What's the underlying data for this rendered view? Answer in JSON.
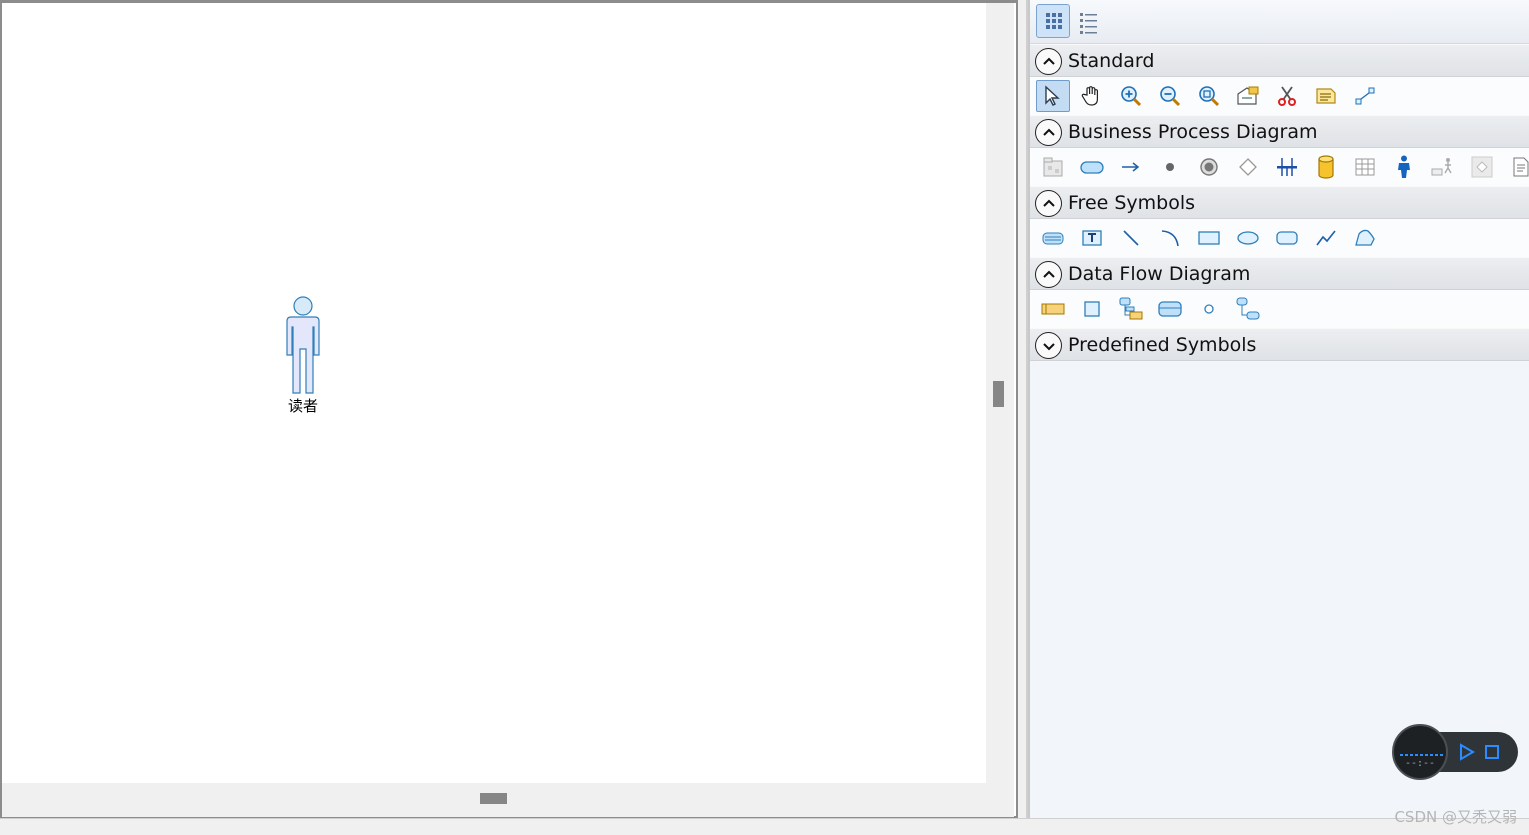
{
  "canvas": {
    "actor": {
      "label": "读者",
      "icon": "actor-icon"
    }
  },
  "toolbox": {
    "modes": [
      {
        "name": "grid-view-icon",
        "active": true
      },
      {
        "name": "list-view-icon",
        "active": false
      }
    ],
    "groups": [
      {
        "title": "Standard",
        "expanded": true,
        "tools": [
          "pointer-icon",
          "hand-icon",
          "zoom-in-icon",
          "zoom-out-icon",
          "zoom-fit-icon",
          "properties-icon",
          "cut-icon",
          "note-icon",
          "link-icon"
        ]
      },
      {
        "title": "Business Process Diagram",
        "expanded": true,
        "tools": [
          "package-icon",
          "process-icon",
          "flow-icon",
          "start-icon",
          "end-icon",
          "decision-icon",
          "sync-icon",
          "resource-icon",
          "table-icon",
          "role-icon",
          "message-icon",
          "part-icon",
          "document-icon"
        ]
      },
      {
        "title": "Free Symbols",
        "expanded": true,
        "tools": [
          "title-icon",
          "text-icon",
          "line-icon",
          "arc-icon",
          "rectangle-icon",
          "ellipse-icon",
          "rounded-rect-icon",
          "polyline-icon",
          "free-shape-icon"
        ]
      },
      {
        "title": "Data Flow Diagram",
        "expanded": true,
        "tools": [
          "data-store-icon",
          "entity-icon",
          "process-tree-icon",
          "storage-icon",
          "split-icon",
          "flow-tree-icon"
        ]
      },
      {
        "title": "Predefined Symbols",
        "expanded": false,
        "tools": []
      }
    ]
  },
  "recorder": {
    "time": "--:--"
  },
  "watermark": "CSDN @又秃又弱"
}
